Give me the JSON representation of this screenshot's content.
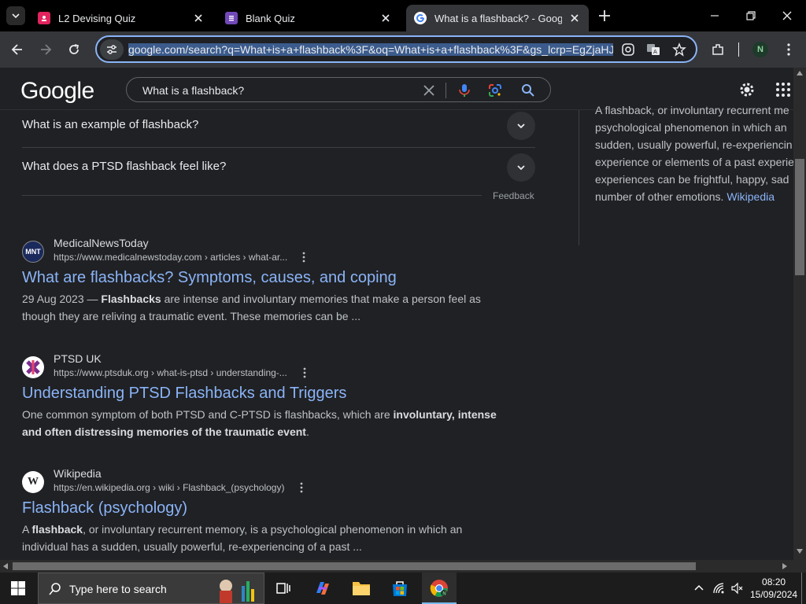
{
  "browser": {
    "tabs": [
      {
        "title": "L2 Devising Quiz",
        "active": false,
        "favicon_color": "#e0245e"
      },
      {
        "title": "Blank Quiz",
        "active": false,
        "favicon_color": "#7248b9"
      },
      {
        "title": "What is a flashback? - Google S",
        "active": true
      }
    ],
    "address_bar": {
      "url": "google.com/search?q=What+is+a+flashback%3F&oq=What+is+a+flashback%3F&gs_lcrp=EgZjaHJvb"
    },
    "profile_initial": "N"
  },
  "google": {
    "logo": "Google",
    "search_query": "What is a flashback?"
  },
  "people_also_ask": [
    {
      "question": "What is an example of flashback?"
    },
    {
      "question": "What does a PTSD flashback feel like?"
    }
  ],
  "feedback_label": "Feedback",
  "results": [
    {
      "site": "MedicalNewsToday",
      "favicon_text": "MNT",
      "url": "https://www.medicalnewstoday.com › articles › what-ar...",
      "title": "What are flashbacks? Symptoms, causes, and coping",
      "snippet_date": "29 Aug 2023 — ",
      "snippet_bold": "Flashbacks",
      "snippet_rest": " are intense and involuntary memories that make a person feel as though they are reliving a traumatic event. These memories can be ..."
    },
    {
      "site": "PTSD UK",
      "url": "https://www.ptsduk.org › what-is-ptsd › understanding-...",
      "title": "Understanding PTSD Flashbacks and Triggers",
      "snippet_pre": "One common symptom of both PTSD and C-PTSD is flashbacks, which are ",
      "snippet_bold": "involuntary, intense and often distressing memories of the traumatic event",
      "snippet_post": "."
    },
    {
      "site": "Wikipedia",
      "favicon_text": "W",
      "url": "https://en.wikipedia.org › wiki › Flashback_(psychology)",
      "title": "Flashback (psychology)",
      "snippet_pre": "A ",
      "snippet_bold": "flashback",
      "snippet_post": ", or involuntary recurrent memory, is a psychological phenomenon in which an individual has a sudden, usually powerful, re-experiencing of a past ..."
    }
  ],
  "knowledge_panel": {
    "lines": [
      "A flashback, or involuntary recurrent me",
      "psychological phenomenon in which an",
      "sudden, usually powerful, re-experiencin",
      "experience or elements of a past experie",
      "experiences can be frightful, happy, sad",
      "number of other emotions. "
    ],
    "source_link": "Wikipedia"
  },
  "taskbar": {
    "search_placeholder": "Type here to search",
    "time": "08:20",
    "date": "15/09/2024"
  },
  "colors": {
    "accent": "#8ab4f8",
    "background": "#202124"
  }
}
